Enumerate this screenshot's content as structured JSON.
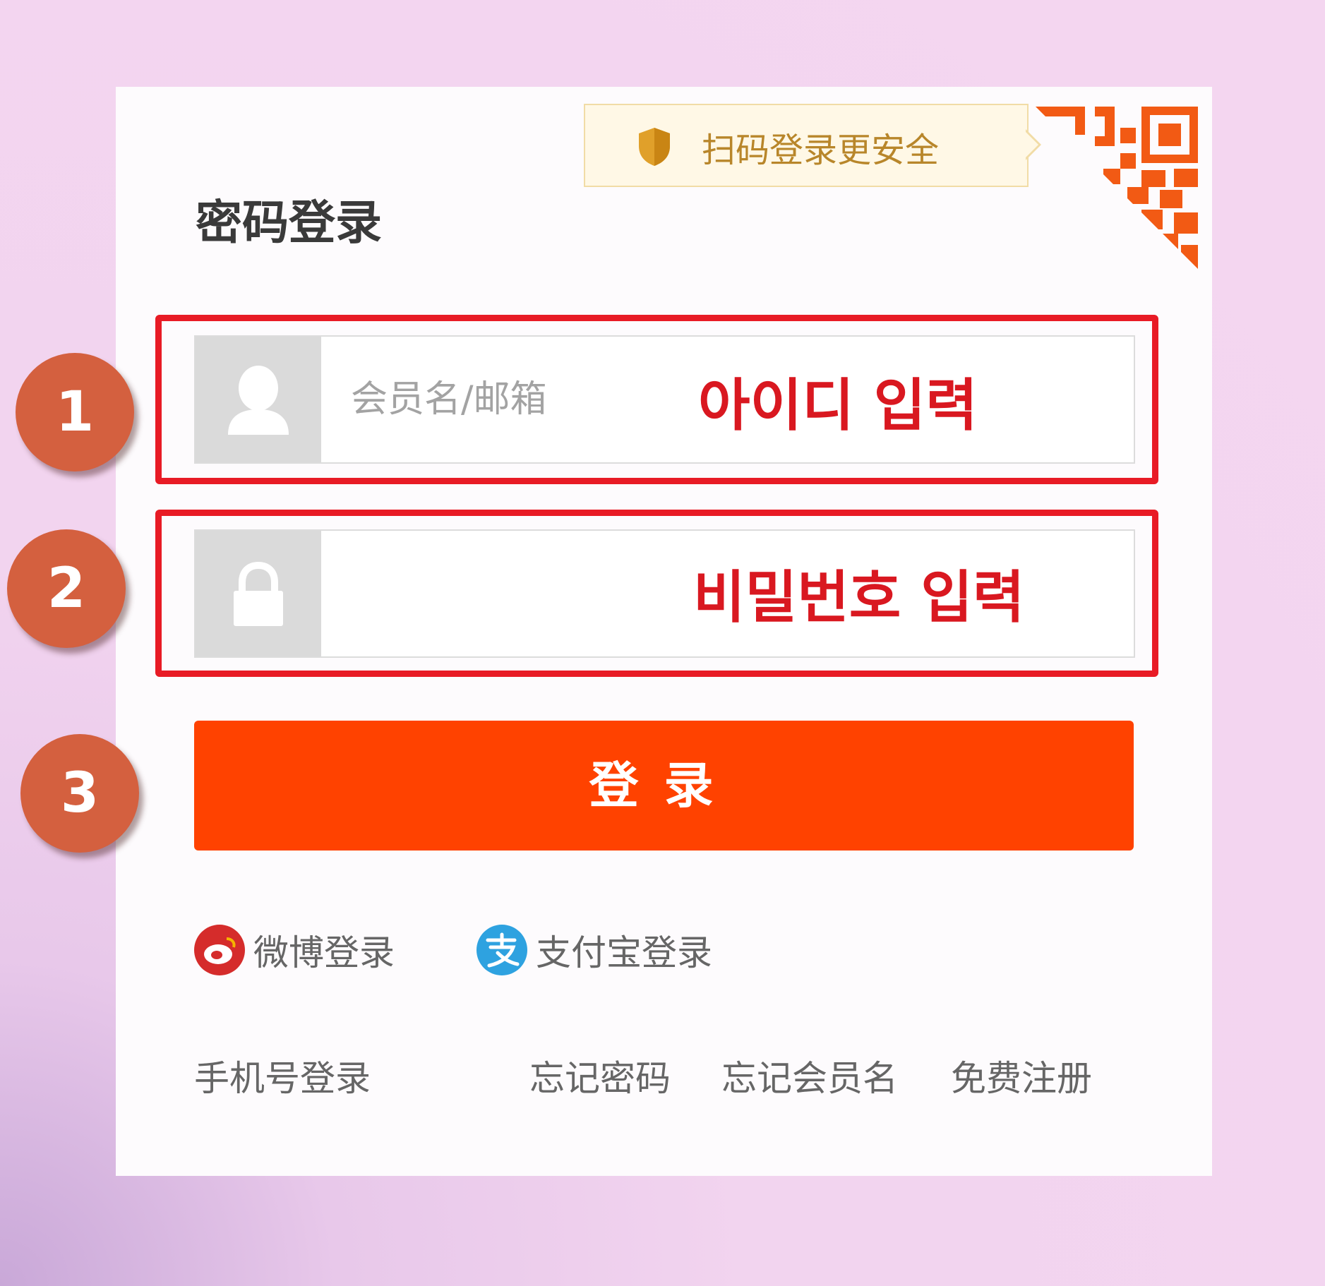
{
  "qr_tip": {
    "text": "扫码登录更安全",
    "shield_icon": "shield-icon",
    "qr_icon": "qr-code-icon"
  },
  "login": {
    "title": "密码登录",
    "username": {
      "placeholder": "会员名/邮箱",
      "value": "",
      "icon": "user-icon"
    },
    "password": {
      "placeholder": "",
      "value": "",
      "icon": "lock-icon"
    },
    "submit_label": "登录"
  },
  "annotations": {
    "step1": "1",
    "step2": "2",
    "step3": "3",
    "id_hint": "아이디 입력",
    "pw_hint": "비밀번호 입력",
    "box_color": "#e81b25",
    "badge_color": "#d4603f"
  },
  "social_login": [
    {
      "label": "微博登录",
      "icon": "weibo-icon",
      "color": "#d52c2b"
    },
    {
      "label": "支付宝登录",
      "icon": "alipay-icon",
      "color": "#2ea2e0"
    }
  ],
  "bottom_links": {
    "phone_login": "手机号登录",
    "forgot_password": "忘记密码",
    "forgot_username": "忘记会员名",
    "register": "免费注册"
  },
  "colors": {
    "accent": "#ff4200",
    "background": "#f4d6f0",
    "card": "#fdfbfd"
  }
}
